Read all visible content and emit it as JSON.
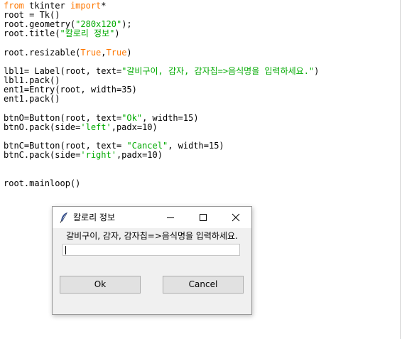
{
  "editor": {
    "lines": [
      [
        {
          "t": "from",
          "c": "kw"
        },
        {
          "t": " tkinter "
        },
        {
          "t": "import",
          "c": "kw"
        },
        {
          "t": "*"
        }
      ],
      [
        {
          "t": "root = Tk()"
        }
      ],
      [
        {
          "t": "root.geometry("
        },
        {
          "t": "\"280x120\"",
          "c": "str"
        },
        {
          "t": ");"
        }
      ],
      [
        {
          "t": "root.title("
        },
        {
          "t": "\"칼로리 정보\"",
          "c": "str"
        },
        {
          "t": ")"
        }
      ],
      [],
      [
        {
          "t": "root.resizable("
        },
        {
          "t": "True",
          "c": "kw"
        },
        {
          "t": ","
        },
        {
          "t": "True",
          "c": "kw"
        },
        {
          "t": ")"
        }
      ],
      [],
      [
        {
          "t": "lbl1= Label(root, text="
        },
        {
          "t": "\"갈비구이, 감자, 감자칩=>음식명을 입력하세요.\"",
          "c": "str"
        },
        {
          "t": ")"
        }
      ],
      [
        {
          "t": "lbl1.pack()"
        }
      ],
      [
        {
          "t": "ent1=Entry(root, width=35)"
        }
      ],
      [
        {
          "t": "ent1.pack()"
        }
      ],
      [],
      [
        {
          "t": "btnO=Button(root, text="
        },
        {
          "t": "\"Ok\"",
          "c": "str"
        },
        {
          "t": ", width=15)"
        }
      ],
      [
        {
          "t": "btnO.pack(side="
        },
        {
          "t": "'left'",
          "c": "str"
        },
        {
          "t": ",padx=10)"
        }
      ],
      [],
      [
        {
          "t": "btnC=Button(root, text= "
        },
        {
          "t": "\"Cancel\"",
          "c": "str"
        },
        {
          "t": ", width=15)"
        }
      ],
      [
        {
          "t": "btnC.pack(side="
        },
        {
          "t": "'right'",
          "c": "str"
        },
        {
          "t": ",padx=10)"
        }
      ],
      [],
      [],
      [
        {
          "t": "root.mainloop()"
        }
      ]
    ],
    "colors": {
      "keyword": "#ff7700",
      "string": "#00aa00",
      "text": "#000000"
    }
  },
  "tk_window": {
    "title": "칼로리 정보",
    "title_icon": "feather-icon",
    "controls": {
      "minimize": "minimize-icon",
      "maximize": "maximize-icon",
      "close": "close-icon"
    },
    "label_text": "갈비구이, 감자, 감자칩=>음식명을 입력하세요.",
    "entry_value": "",
    "ok_label": "Ok",
    "cancel_label": "Cancel",
    "colors": {
      "window_bg": "#f0f0f0",
      "titlebar_bg": "#ffffff",
      "button_bg": "#e1e1e1",
      "button_border": "#adadad"
    }
  }
}
